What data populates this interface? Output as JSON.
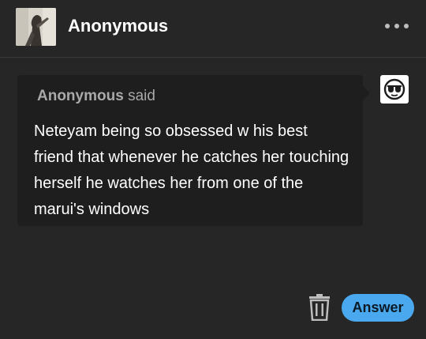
{
  "header": {
    "blog_name": "Anonymous",
    "avatar_icon": "profile-photo",
    "menu_icon": "more-dots-icon"
  },
  "ask": {
    "asker_name": "Anonymous",
    "said_label": "said",
    "text": "Neteyam being so obsessed w his best friend that whenever he catches her touching herself he watches her from one of the marui's windows",
    "asker_avatar_icon": "anonymous-sunglasses-icon"
  },
  "actions": {
    "delete_icon": "trash-icon",
    "answer_label": "Answer"
  },
  "colors": {
    "background": "#262626",
    "bubble": "#1e1e1e",
    "accent": "#4aa8ee",
    "muted_text": "#a9a9a9"
  }
}
